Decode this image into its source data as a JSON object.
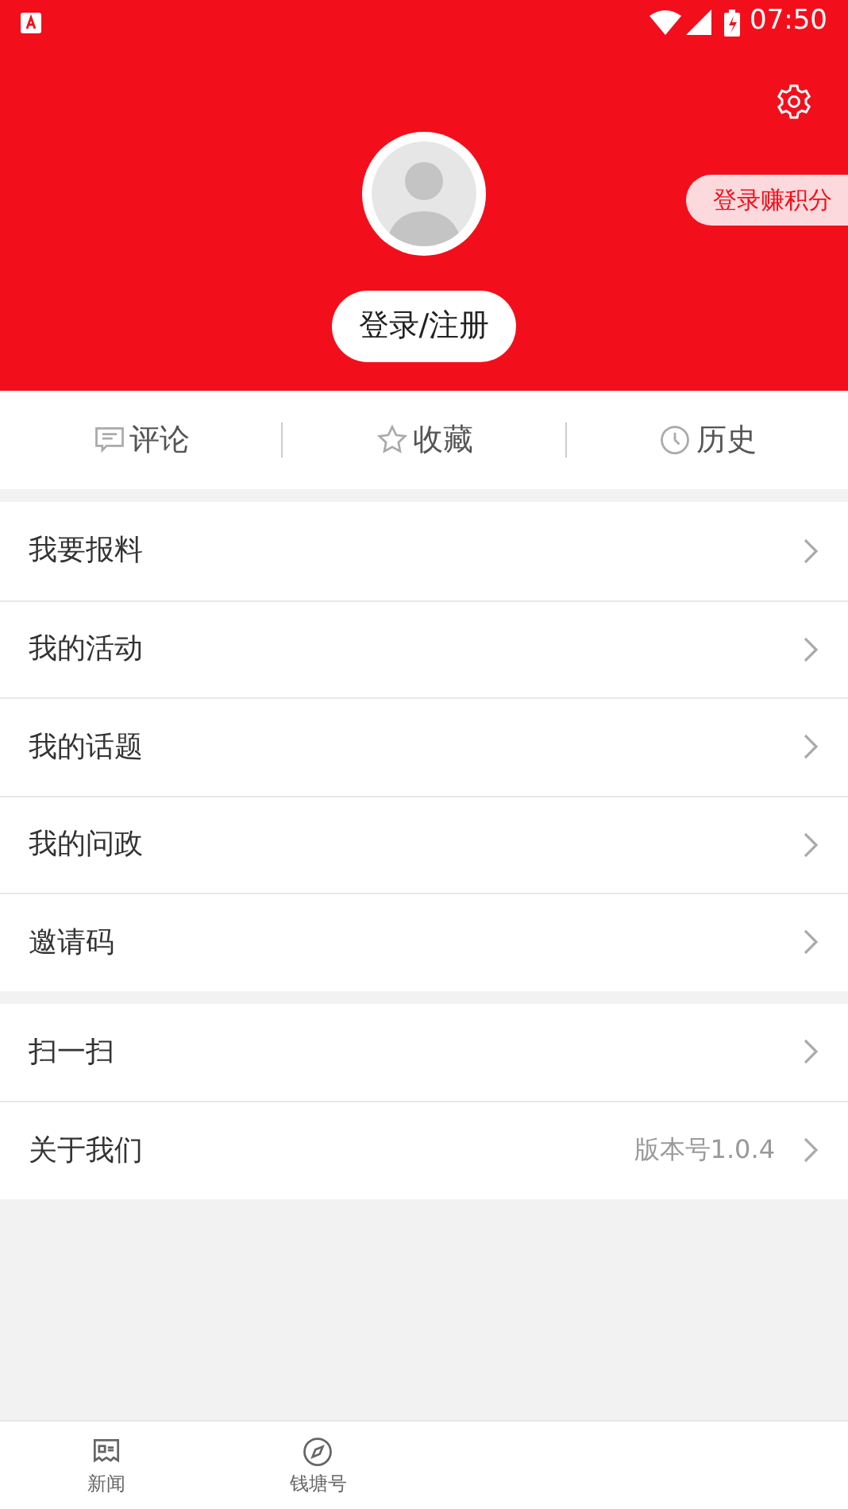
{
  "status_bar": {
    "time": "07:50"
  },
  "header": {
    "login_button": "登录/注册",
    "points_badge": "登录赚积分"
  },
  "quick_tabs": [
    {
      "label": "评论",
      "kind": "comment"
    },
    {
      "label": "收藏",
      "kind": "star"
    },
    {
      "label": "历史",
      "kind": "clock"
    }
  ],
  "menu_groups": [
    [
      {
        "label": "我要报料"
      },
      {
        "label": "我的活动"
      },
      {
        "label": "我的话题"
      },
      {
        "label": "我的问政"
      },
      {
        "label": "邀请码"
      }
    ],
    [
      {
        "label": "扫一扫"
      },
      {
        "label": "关于我们",
        "value": "版本号1.0.4"
      }
    ]
  ],
  "bottom_nav": [
    {
      "label": "新闻",
      "kind": "news"
    },
    {
      "label": "钱塘号",
      "kind": "compass"
    }
  ]
}
